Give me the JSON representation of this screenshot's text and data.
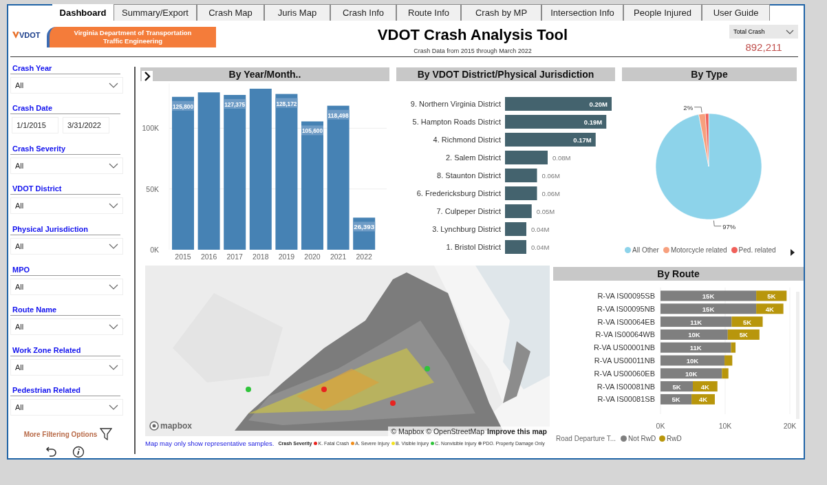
{
  "tabs": [
    {
      "label": "Dashboard",
      "selected": true
    },
    {
      "label": "Summary/Export",
      "selected": false
    },
    {
      "label": "Crash Map",
      "selected": false
    },
    {
      "label": "Juris Map",
      "selected": false
    },
    {
      "label": "Crash Info",
      "selected": false
    },
    {
      "label": "Route Info",
      "selected": false
    },
    {
      "label": "Crash by MP",
      "selected": false
    },
    {
      "label": "Intersection Info",
      "selected": false
    },
    {
      "label": "People Injured",
      "selected": false
    },
    {
      "label": "User Guide",
      "selected": false
    }
  ],
  "header": {
    "logo_text": "VDOT",
    "banner": [
      "Virginia Department of Transportation",
      "Traffic Engineering"
    ],
    "title": "VDOT Crash Analysis Tool",
    "subtitle": "Crash Data from 2015 through March 2022",
    "measure_selector": "Total Crash",
    "kpi": "892,211"
  },
  "filters": [
    {
      "kind": "dropdown",
      "label": "Crash Year",
      "value": "All"
    },
    {
      "kind": "daterange",
      "label": "Crash Date",
      "values": [
        "1/1/2015",
        "3/31/2022"
      ]
    },
    {
      "kind": "dropdown",
      "label": "Crash Severity",
      "value": "All"
    },
    {
      "kind": "dropdown",
      "label": "VDOT District",
      "value": "All"
    },
    {
      "kind": "dropdown",
      "label": "Physical Jurisdiction",
      "value": "All"
    },
    {
      "kind": "dropdown",
      "label": "MPO",
      "value": "All"
    },
    {
      "kind": "dropdown",
      "label": "Route Name",
      "value": "All"
    },
    {
      "kind": "dropdown",
      "label": "Work Zone Related",
      "value": "All"
    },
    {
      "kind": "dropdown",
      "label": "Pedestrian Related",
      "value": "All"
    }
  ],
  "more_filters": "More Filtering Options",
  "year_panel": {
    "title": "By Year/Month..",
    "chart_data": {
      "type": "bar",
      "categories": [
        "2015",
        "2016",
        "2017",
        "2018",
        "2019",
        "2020",
        "2021",
        "2022"
      ],
      "values": [
        125800,
        129500,
        127375,
        132500,
        128172,
        105600,
        118498,
        26393
      ],
      "value_labels": [
        "125,800",
        null,
        "127,375",
        null,
        "128,172",
        "105,600",
        "118,498",
        "26,393"
      ],
      "ylim": [
        0,
        137000
      ],
      "yticks": [
        {
          "value": 0,
          "label": "0K"
        },
        {
          "value": 50000,
          "label": "50K"
        },
        {
          "value": 100000,
          "label": "100K"
        }
      ]
    }
  },
  "district_panel": {
    "title": "By VDOT District/Physical Jurisdiction",
    "chart_data": {
      "type": "bar",
      "orientation": "horizontal",
      "categories": [
        "9. Northern Virginia District",
        "5. Hampton Roads District",
        "4. Richmond District",
        "2. Salem District",
        "8. Staunton District",
        "6. Fredericksburg District",
        "7. Culpeper District",
        "3. Lynchburg District",
        "1. Bristol District"
      ],
      "values": [
        0.2,
        0.19,
        0.17,
        0.08,
        0.06,
        0.06,
        0.05,
        0.04,
        0.04
      ],
      "value_labels": [
        "0.20M",
        "0.19M",
        "0.17M",
        "0.08M",
        "0.06M",
        "0.06M",
        "0.05M",
        "0.04M",
        "0.04M"
      ]
    }
  },
  "type_panel": {
    "title": "By Type",
    "chart_data": {
      "type": "pie",
      "categories": [
        "All Other",
        "Motorcycle related",
        "Ped. related"
      ],
      "values": [
        97,
        2,
        1
      ],
      "value_labels": [
        "97%",
        "2%",
        null
      ],
      "colors": [
        "#8dd3ea",
        "#f7a07e",
        "#f0605a"
      ]
    }
  },
  "map": {
    "logo": "mapbox",
    "attribution": "© Mapbox © OpenStreetMap",
    "improve_link": "Improve this map",
    "note": "Map may only show representative samples.",
    "legend_title": "Crash Severity",
    "legend": [
      {
        "label": "K. Fatal Crash",
        "color": "#e8231f"
      },
      {
        "label": "A. Severe Injury",
        "color": "#f08c1a"
      },
      {
        "label": "B. Visible Injury",
        "color": "#f2e21e"
      },
      {
        "label": "C. Nonvisible Injury",
        "color": "#2fc43a"
      },
      {
        "label": "PDO. Property Damage Only",
        "color": "#8a8a8a"
      }
    ]
  },
  "route_panel": {
    "title": "By Route",
    "legend_title": "Road Departure T...",
    "chart_data": {
      "type": "bar",
      "orientation": "horizontal",
      "stacked": true,
      "categories": [
        "R-VA IS00095SB",
        "R-VA IS00095NB",
        "R-VA IS00064EB",
        "R-VA IS00064WB",
        "R-VA US00001NB",
        "R-VA US00011NB",
        "R-VA US00060EB",
        "R-VA IS00081NB",
        "R-VA IS00081SB"
      ],
      "series": [
        {
          "name": "Not RwD",
          "color": "#7f7f7f",
          "values": [
            14800,
            14800,
            11000,
            10400,
            10900,
            9900,
            9500,
            5000,
            4800
          ],
          "value_labels": [
            "15K",
            "15K",
            "11K",
            "10K",
            "11K",
            "10K",
            "10K",
            "5K",
            "5K"
          ]
        },
        {
          "name": "RwD",
          "color": "#b8960c",
          "values": [
            4700,
            4200,
            4800,
            4900,
            700,
            1200,
            1000,
            3800,
            3600
          ],
          "value_labels": [
            "5K",
            "4K",
            "5K",
            "5K",
            null,
            null,
            null,
            "4K",
            "4K"
          ]
        }
      ],
      "xlim": [
        0,
        20000
      ],
      "xticks": [
        {
          "value": 0,
          "label": "0K"
        },
        {
          "value": 10000,
          "label": "10K"
        },
        {
          "value": 20000,
          "label": "20K"
        }
      ]
    }
  }
}
